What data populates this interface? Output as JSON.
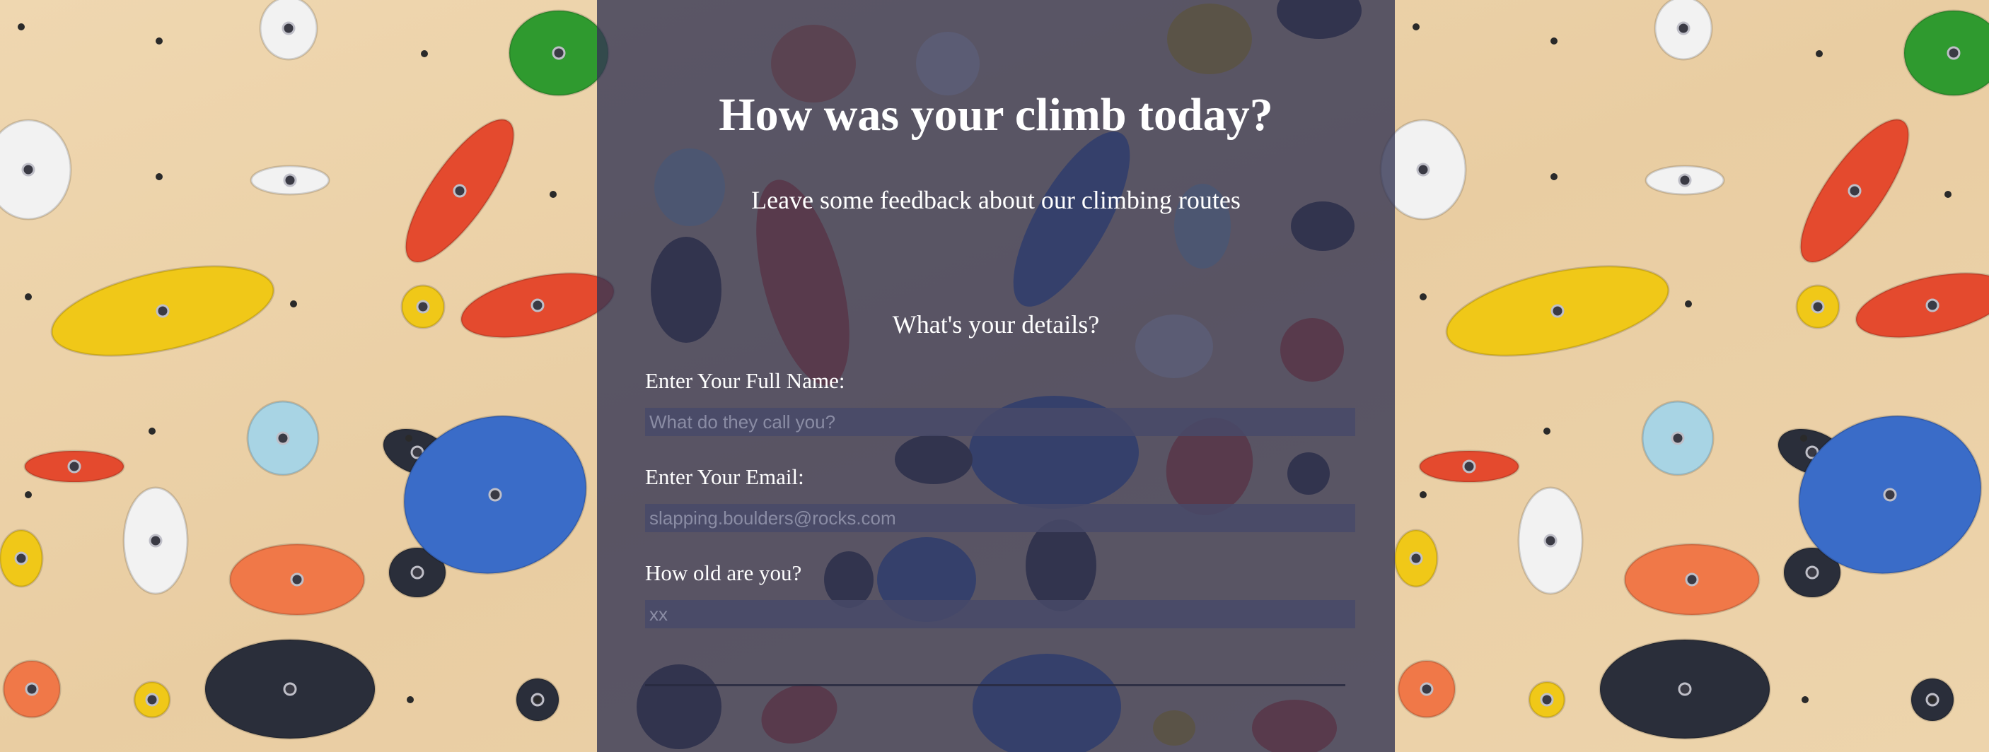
{
  "form": {
    "title": "How was your climb today?",
    "subtitle": "Leave some feedback about our climbing routes",
    "details_heading": "What's your details?",
    "fields": [
      {
        "label": "Enter Your Full Name:",
        "placeholder": "What do they call you?",
        "value": ""
      },
      {
        "label": "Enter Your Email:",
        "placeholder": "slapping.boulders@rocks.com",
        "value": ""
      },
      {
        "label": "How old are you?",
        "placeholder": "xx",
        "value": ""
      }
    ]
  },
  "background": {
    "wall_color": "#ecd2aa",
    "overlay_color": "#343654",
    "hold_colors": [
      "#2f9a2f",
      "#e44a2e",
      "#f0c818",
      "#3a6cc8",
      "#2a2e3a",
      "#f2f2f2",
      "#a8d4e4",
      "#f07848"
    ]
  }
}
